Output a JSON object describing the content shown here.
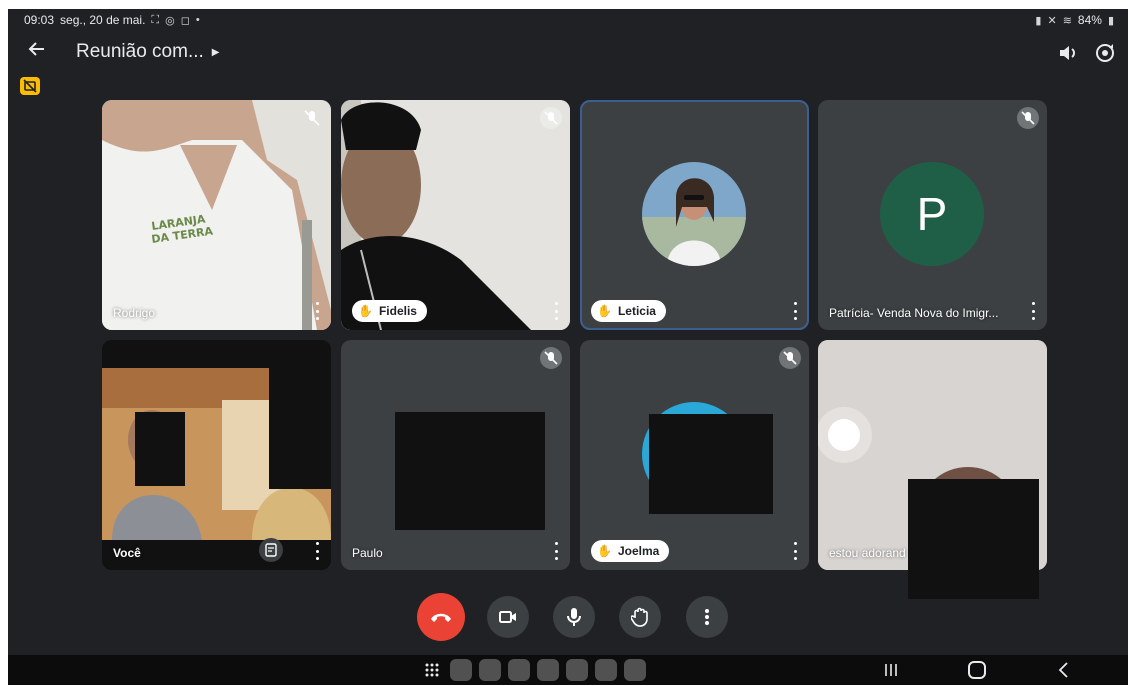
{
  "status_bar": {
    "time": "09:03",
    "date": "seg., 20 de mai.",
    "battery": "84%"
  },
  "header": {
    "title": "Reunião com...",
    "icons": [
      "back-arrow-icon",
      "caret-right-icon",
      "speaker-icon",
      "switch-camera-icon"
    ]
  },
  "participants": [
    {
      "name": "Rodrigo",
      "hand_raised": false,
      "muted": true
    },
    {
      "name": "Fidelis",
      "hand_raised": true,
      "muted": true
    },
    {
      "name": "Leticia",
      "hand_raised": true,
      "muted": false,
      "active": true
    },
    {
      "name": "Patrícia- Venda Nova do Imigr...",
      "hand_raised": false,
      "muted": true,
      "avatar_letter": "P"
    },
    {
      "name": "Você",
      "hand_raised": false,
      "muted": false
    },
    {
      "name": "Paulo",
      "hand_raised": false,
      "muted": true
    },
    {
      "name": "Joelma",
      "hand_raised": true,
      "muted": true
    },
    {
      "name": "estou adorand",
      "hand_raised": false,
      "muted": false
    }
  ],
  "controls": [
    "end-call-icon",
    "camera-icon",
    "microphone-icon",
    "raise-hand-icon",
    "more-options-icon"
  ],
  "colors": {
    "background": "#202124",
    "tile": "#3c4043",
    "end_call": "#ea4335",
    "avatar_p": "#1f5f47",
    "active_outline": "#3d5f8f",
    "caption_badge": "#fbbc04"
  }
}
